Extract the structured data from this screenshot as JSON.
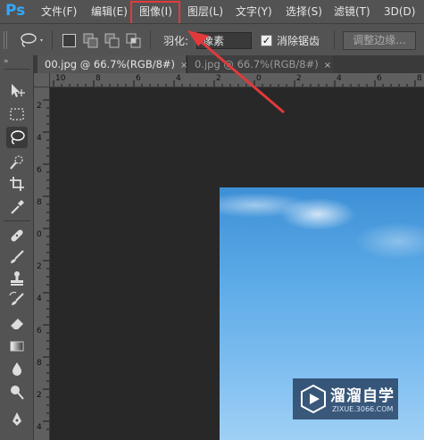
{
  "menu": {
    "logo": "Ps",
    "items": [
      "文件(F)",
      "编辑(E)",
      "图像(I)",
      "图层(L)",
      "文字(Y)",
      "选择(S)",
      "滤镜(T)",
      "3D(D)"
    ],
    "highlighted": "图像(I)"
  },
  "options": {
    "feather_label": "羽化:",
    "feather_value": "像素",
    "antialias_label": "消除锯齿",
    "antialias_checked": true,
    "refine_edge": "调整边缘..."
  },
  "tabs": [
    {
      "title": "00.jpg @ 66.7%(RGB/8#)",
      "close": "×",
      "active": true
    },
    {
      "title": "0.jpg @ 66.7%(RGB/8#)",
      "close": "×",
      "active": false
    }
  ],
  "rulers": {
    "horizontal": [
      "10",
      "8",
      "6",
      "4",
      "2",
      "0",
      "2",
      "4",
      "6",
      "8"
    ],
    "vertical": [
      "2",
      "4",
      "6",
      "8",
      "0",
      "2",
      "4",
      "6",
      "8",
      "2",
      "4"
    ]
  },
  "tools": [
    "move-tool",
    "marquee-tool",
    "lasso-tool",
    "quick-selection-tool",
    "crop-tool",
    "eyedropper-tool",
    "healing-brush-tool",
    "brush-tool",
    "clone-stamp-tool",
    "history-brush-tool",
    "eraser-tool",
    "gradient-tool",
    "blur-tool",
    "dodge-tool",
    "pen-tool"
  ],
  "active_tool": "lasso-tool",
  "watermark": {
    "title": "溜溜自学",
    "subtitle": "ZIXUE.3066.COM"
  },
  "colors": {
    "highlight": "#e23a3a",
    "ps_logo": "#31a8ff",
    "panel": "#535353",
    "canvas_bg": "#282828"
  }
}
